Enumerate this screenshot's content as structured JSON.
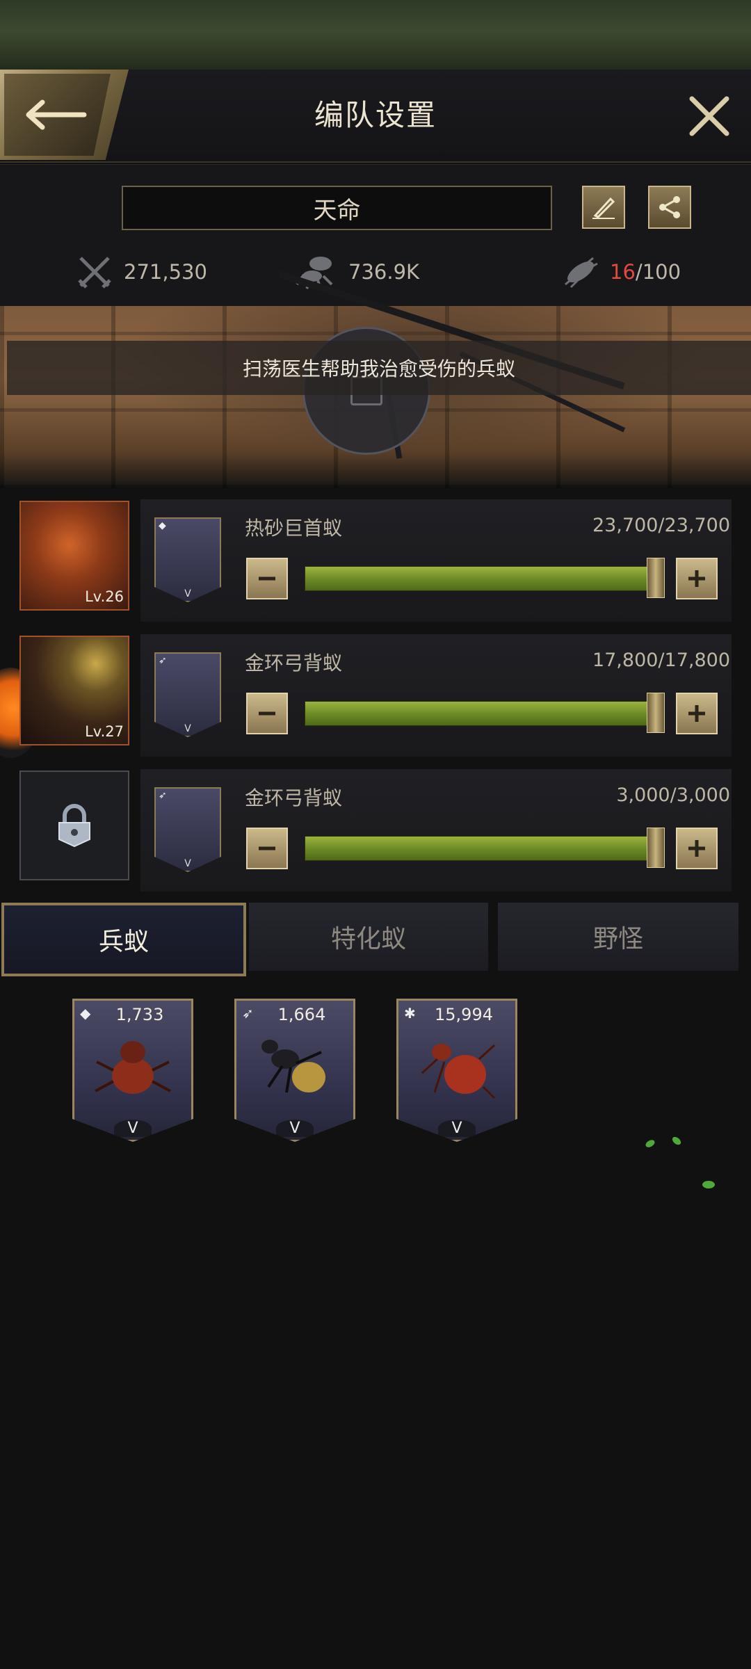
{
  "header": {
    "title": "编队设置"
  },
  "team": {
    "name": "天命",
    "power": "271,530",
    "load": "736.9K",
    "count_current": "16",
    "count_separator": "/",
    "count_max": "100"
  },
  "banner": {
    "tip": "扫荡医生帮助我治愈受伤的兵蚁"
  },
  "rows": [
    {
      "level": "Lv.26",
      "unit_name": "热砂巨首蚁",
      "count": "23,700/23,700",
      "rank": "V",
      "fill": 1.0
    },
    {
      "level": "Lv.27",
      "unit_name": "金环弓背蚁",
      "count": "17,800/17,800",
      "rank": "V",
      "fill": 1.0
    },
    {
      "level": "",
      "unit_name": "金环弓背蚁",
      "count": "3,000/3,000",
      "rank": "V",
      "fill": 1.0
    }
  ],
  "tabs": [
    "兵蚁",
    "特化蚁",
    "野怪"
  ],
  "cards": [
    {
      "count": "1,733",
      "rank": "V",
      "role_icon": "shield-icon"
    },
    {
      "count": "1,664",
      "rank": "V",
      "role_icon": "bow-icon"
    },
    {
      "count": "15,994",
      "rank": "V",
      "role_icon": "ant-icon"
    }
  ]
}
